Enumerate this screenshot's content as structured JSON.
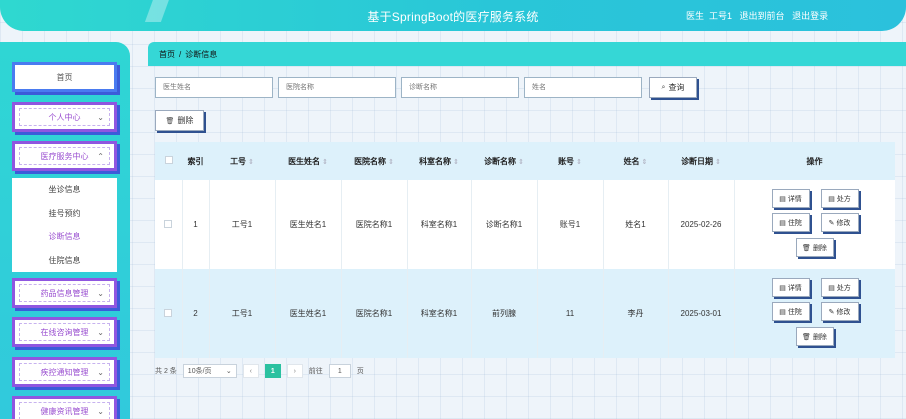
{
  "header": {
    "title": "基于SpringBoot的医疗服务系统",
    "user_role": "医生",
    "user_name": "工号1",
    "goto_front": "退出到前台",
    "logout": "退出登录"
  },
  "sidebar": {
    "items": [
      {
        "label": "首页"
      },
      {
        "label": "个人中心"
      },
      {
        "label": "医疗服务中心"
      },
      {
        "label": "药品信息管理"
      },
      {
        "label": "在线咨询管理"
      },
      {
        "label": "疾控通知管理"
      },
      {
        "label": "健康资讯管理"
      }
    ],
    "submenu": [
      {
        "label": "坐诊信息"
      },
      {
        "label": "挂号预约"
      },
      {
        "label": "诊断信息"
      },
      {
        "label": "住院信息"
      }
    ]
  },
  "breadcrumb": {
    "home": "首页",
    "separator": "/",
    "current": "诊断信息"
  },
  "search": {
    "doctor_name_placeholder": "医生姓名",
    "hospital_name_placeholder": "医院名称",
    "diagnosis_name_placeholder": "诊断名称",
    "name_placeholder": "姓名",
    "query_label": "查询",
    "delete_label": "删除"
  },
  "table": {
    "columns": [
      "索引",
      "工号",
      "医生姓名",
      "医院名称",
      "科室名称",
      "诊断名称",
      "账号",
      "姓名",
      "诊断日期",
      "操作"
    ],
    "rows": [
      {
        "index": "1",
        "job_no": "工号1",
        "doctor": "医生姓名1",
        "hospital": "医院名称1",
        "dept": "科室名称1",
        "diagnosis": "诊断名称1",
        "account": "账号1",
        "name": "姓名1",
        "date": "2025-02-26"
      },
      {
        "index": "2",
        "job_no": "工号1",
        "doctor": "医生姓名1",
        "hospital": "医院名称1",
        "dept": "科室名称1",
        "diagnosis": "前列腺",
        "account": "11",
        "name": "李丹",
        "date": "2025-03-01"
      }
    ],
    "ops": {
      "detail": "详情",
      "prescription": "处方",
      "hospitalize": "住院",
      "edit": "修改",
      "delete": "删除"
    }
  },
  "pager": {
    "total": "共 2 条",
    "page_size": "10条/页",
    "current_page": "1",
    "goto_label": "前往",
    "goto_value": "1",
    "page_unit": "页"
  },
  "colors": {
    "accent": "#2fd6d4",
    "button_shadow": "#2f5190",
    "active_page": "#2bc1a0",
    "menu_border": "#4a7bf0"
  },
  "icons": [
    "search-icon",
    "trash-icon",
    "detail-icon",
    "prescription-icon",
    "hospitalize-icon",
    "edit-icon",
    "chevron-down-icon",
    "chevron-left-icon",
    "chevron-right-icon"
  ]
}
